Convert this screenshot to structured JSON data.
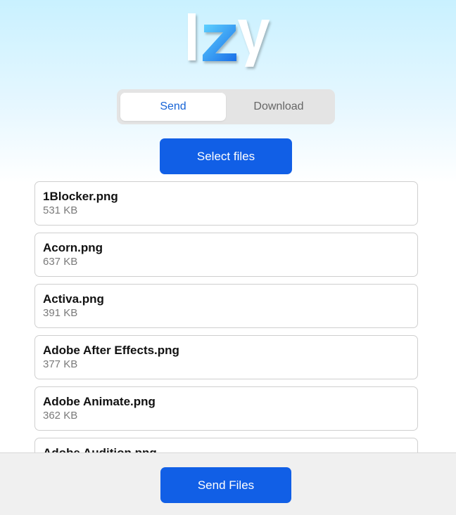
{
  "app": {
    "logo_text": "Izy"
  },
  "tabs": [
    {
      "label": "Send",
      "active": true
    },
    {
      "label": "Download",
      "active": false
    }
  ],
  "select_button_label": "Select files",
  "files": [
    {
      "name": "1Blocker.png",
      "size": "531 KB"
    },
    {
      "name": "Acorn.png",
      "size": "637 KB"
    },
    {
      "name": "Activa.png",
      "size": "391 KB"
    },
    {
      "name": "Adobe After Effects.png",
      "size": "377 KB"
    },
    {
      "name": "Adobe Animate.png",
      "size": "362 KB"
    },
    {
      "name": "Adobe Audition.png",
      "size": ""
    }
  ],
  "send_button_label": "Send Files",
  "colors": {
    "accent": "#115fe6",
    "active_tab_text": "#1663d6",
    "footer_bg": "#f0f0f0"
  }
}
